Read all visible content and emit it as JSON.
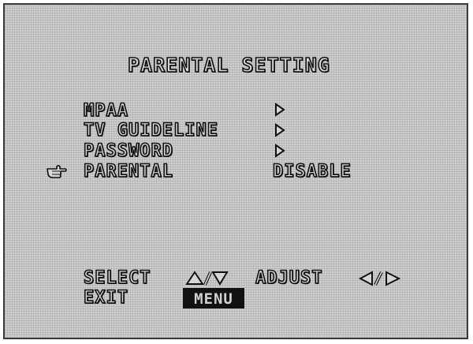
{
  "menu": {
    "title": "PARENTAL SETTING",
    "items": [
      {
        "label": "MPAA",
        "value": ""
      },
      {
        "label": "TV GUIDELINE",
        "value": ""
      },
      {
        "label": "PASSWORD",
        "value": ""
      },
      {
        "label": "PARENTAL",
        "value": "DISABLE"
      }
    ],
    "selected_index": 3
  },
  "footer": {
    "select_label": "SELECT",
    "adjust_label": "ADJUST",
    "exit_label": "EXIT",
    "menu_key": "MENU"
  },
  "icons": [
    "pointing-hand-icon",
    "triangle-right-icon",
    "triangle-up-icon",
    "triangle-down-icon",
    "triangle-left-icon"
  ],
  "colors": {
    "background": "#cfcfcf",
    "text_fill": "#d6d6d6",
    "text_outline": "#111111"
  }
}
